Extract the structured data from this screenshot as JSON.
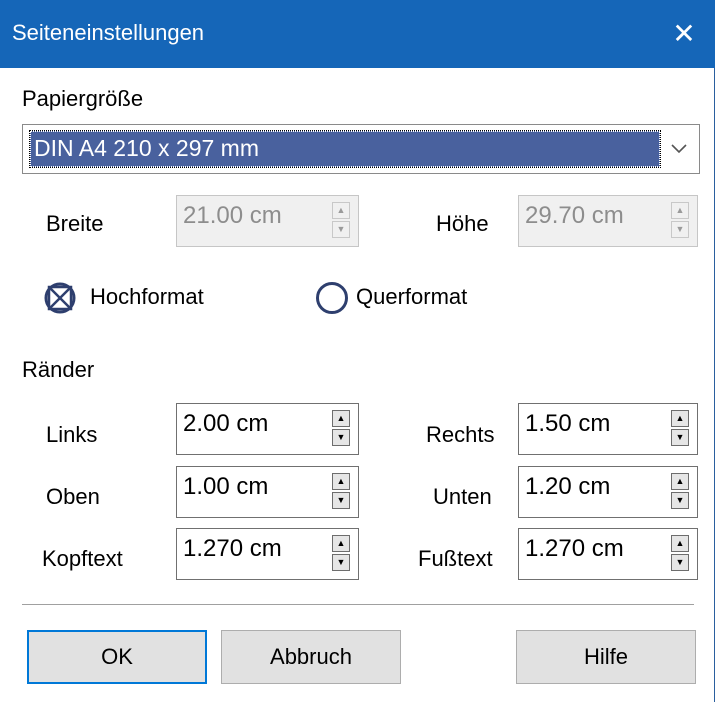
{
  "window": {
    "title": "Seiteneinstellungen"
  },
  "paper": {
    "section_label": "Papiergröße",
    "selected": "DIN A4 210 x 297 mm",
    "width_label": "Breite",
    "width_value": "21.00 cm",
    "height_label": "Höhe",
    "height_value": "29.70 cm"
  },
  "orientation": {
    "portrait_label": "Hochformat",
    "landscape_label": "Querformat",
    "selected": "portrait"
  },
  "margins": {
    "section_label": "Ränder",
    "left_label": "Links",
    "left_value": "2.00 cm",
    "right_label": "Rechts",
    "right_value": "1.50 cm",
    "top_label": "Oben",
    "top_value": "1.00 cm",
    "bottom_label": "Unten",
    "bottom_value": "1.20 cm",
    "header_label": "Kopftext",
    "header_value": "1.270 cm",
    "footer_label": "Fußtext",
    "footer_value": "1.270 cm"
  },
  "buttons": {
    "ok": "OK",
    "cancel": "Abbruch",
    "help": "Hilfe"
  },
  "icons": {
    "close": "close-icon",
    "dropdown": "chevron-down-icon",
    "spin_up": "spin-up-icon",
    "spin_down": "spin-down-icon"
  },
  "colors": {
    "titlebar": "#1566b8",
    "selection": "#49619e",
    "default_button_border": "#0078d7"
  }
}
